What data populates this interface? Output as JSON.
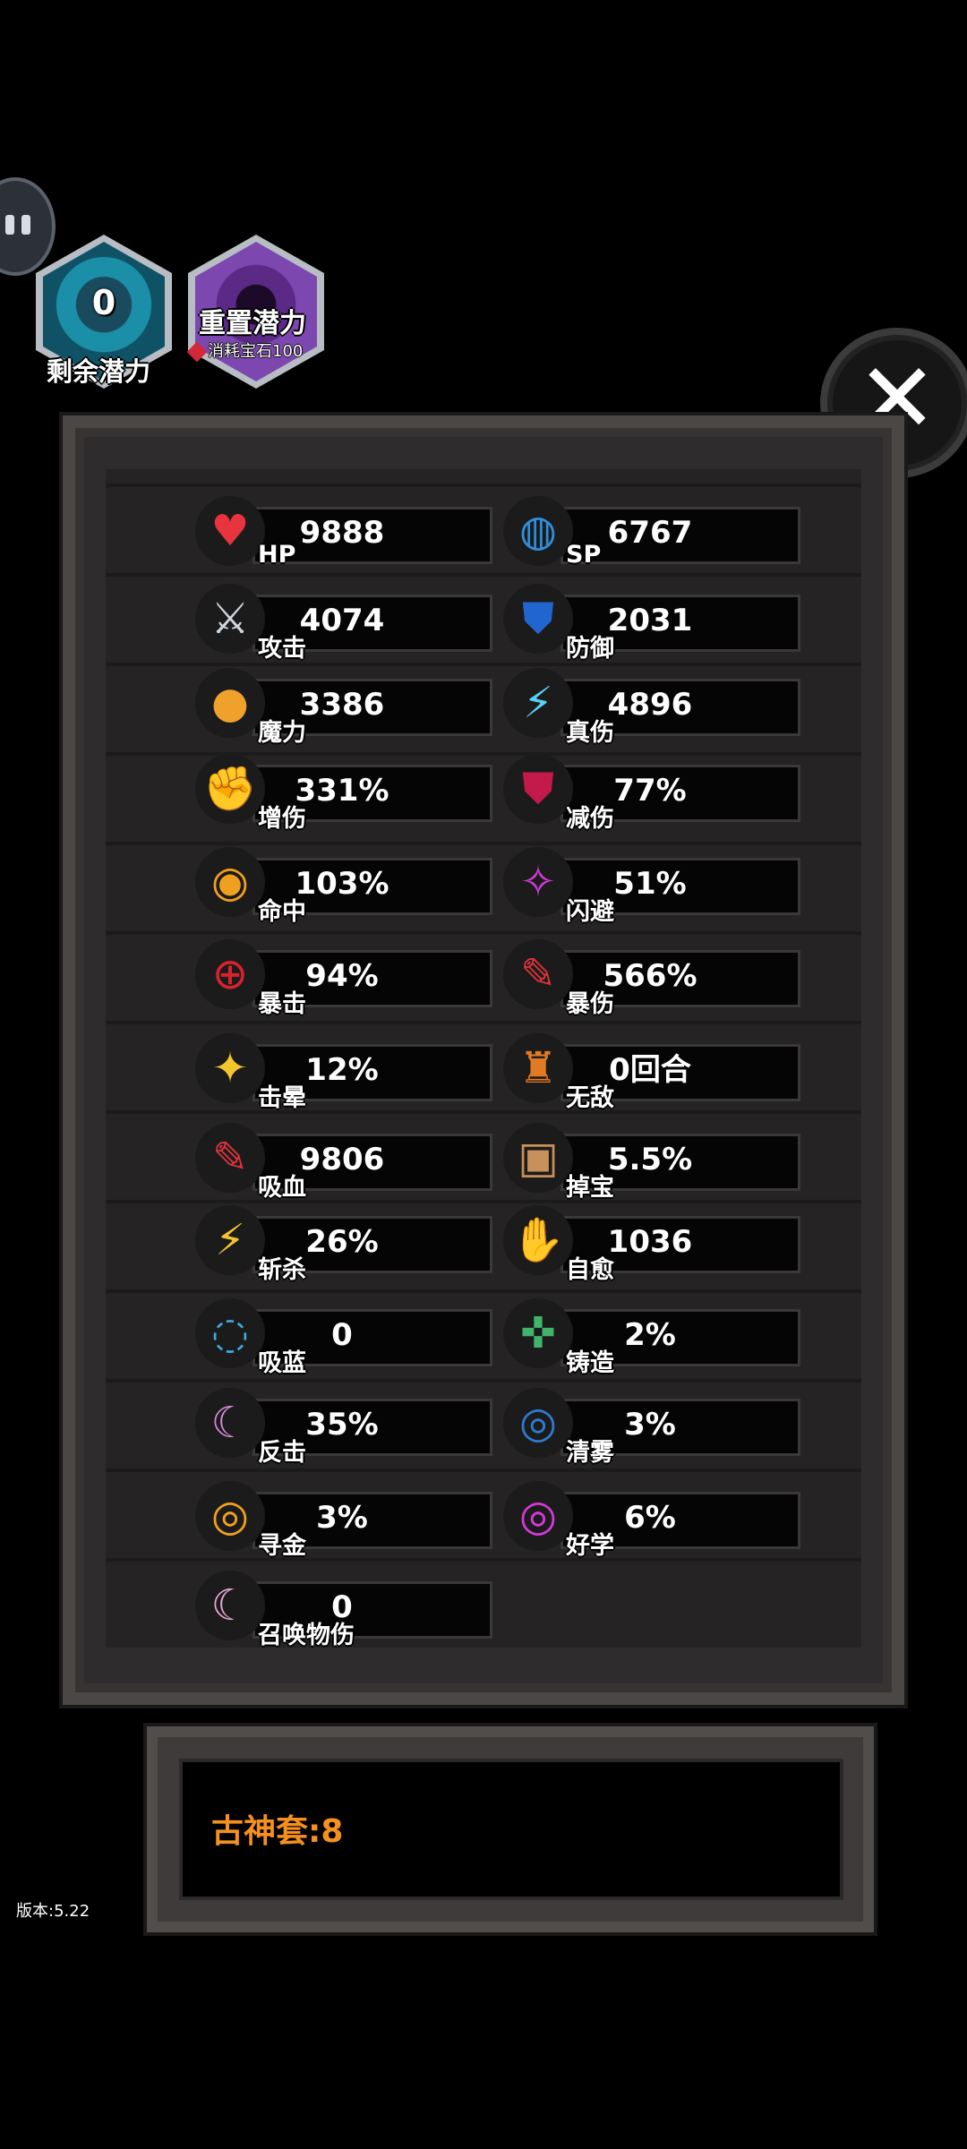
{
  "potential": {
    "remaining_value": "0",
    "remaining_label": "剩余潜力",
    "reset_label": "重置潜力",
    "reset_cost": "消耗宝石100"
  },
  "close_icon": "✕",
  "stats_left": [
    {
      "label": "HP",
      "value": "9888",
      "icon": "heart-icon"
    },
    {
      "label": "攻击",
      "value": "4074",
      "icon": "crossed-swords-icon"
    },
    {
      "label": "魔力",
      "value": "3386",
      "icon": "orb-icon"
    },
    {
      "label": "增伤",
      "value": "331%",
      "icon": "fist-icon"
    },
    {
      "label": "命中",
      "value": "103%",
      "icon": "eye-icon"
    },
    {
      "label": "暴击",
      "value": "94%",
      "icon": "crosshair-icon"
    },
    {
      "label": "击晕",
      "value": "12%",
      "icon": "stars-icon"
    },
    {
      "label": "吸血",
      "value": "9806",
      "icon": "blood-vial-icon"
    },
    {
      "label": "斩杀",
      "value": "26%",
      "icon": "claw-icon"
    },
    {
      "label": "吸蓝",
      "value": "0",
      "icon": "bubbles-icon"
    },
    {
      "label": "反击",
      "value": "35%",
      "icon": "crescent-icon"
    },
    {
      "label": "寻金",
      "value": "3%",
      "icon": "gold-coin-icon"
    },
    {
      "label": "召唤物伤",
      "value": "0",
      "icon": "summon-icon"
    }
  ],
  "stats_right": [
    {
      "label": "SP",
      "value": "6767",
      "icon": "swirl-icon"
    },
    {
      "label": "防御",
      "value": "2031",
      "icon": "blue-shield-icon"
    },
    {
      "label": "真伤",
      "value": "4896",
      "icon": "lightning-icon"
    },
    {
      "label": "减伤",
      "value": "77%",
      "icon": "red-shield-icon"
    },
    {
      "label": "闪避",
      "value": "51%",
      "icon": "dodge-icon"
    },
    {
      "label": "暴伤",
      "value": "566%",
      "icon": "crit-damage-icon"
    },
    {
      "label": "无敌",
      "value": "0回合",
      "icon": "invincible-icon"
    },
    {
      "label": "掉宝",
      "value": "5.5%",
      "icon": "treasure-chest-icon"
    },
    {
      "label": "自愈",
      "value": "1036",
      "icon": "healing-hand-icon"
    },
    {
      "label": "铸造",
      "value": "2%",
      "icon": "forge-icon"
    },
    {
      "label": "清雾",
      "value": "3%",
      "icon": "fog-icon"
    },
    {
      "label": "好学",
      "value": "6%",
      "icon": "study-icon"
    }
  ],
  "set_bonus": "古神套:8",
  "version": "版本:5.22"
}
